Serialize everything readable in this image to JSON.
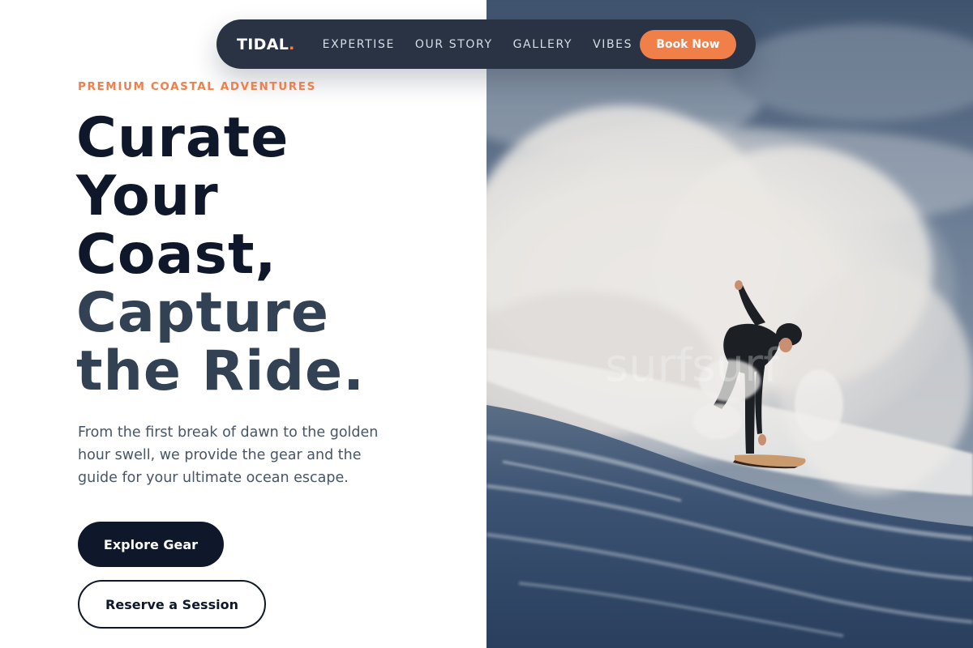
{
  "nav": {
    "brand": "TIDAL",
    "brand_dot": ".",
    "links": [
      "EXPERTISE",
      "OUR STORY",
      "GALLERY",
      "VIBES"
    ],
    "cta": "Book Now"
  },
  "hero": {
    "eyebrow": "PREMIUM COASTAL ADVENTURES",
    "headline_dark": [
      "Curate",
      "Your",
      "Coast,"
    ],
    "headline_light": [
      "Capture",
      "the Ride."
    ],
    "lead": "From the first break of dawn to the golden hour swell, we provide the gear and the guide for your ultimate ocean escape.",
    "primary_button": "Explore Gear",
    "secondary_button": "Reserve a Session",
    "image_watermark": "surfsurf"
  },
  "colors": {
    "accent": "#f07f4a",
    "navy": "#0f172a",
    "slate": "#334155",
    "nav_bg": "#2a3344"
  }
}
